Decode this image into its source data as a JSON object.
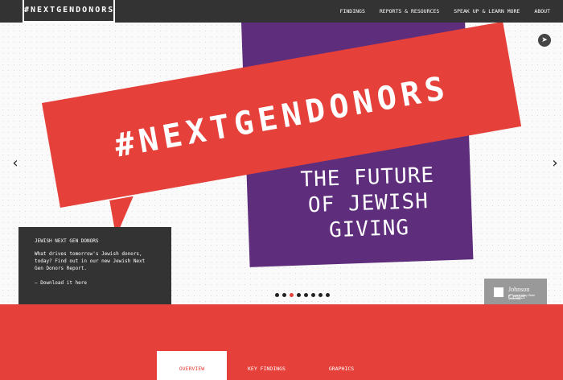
{
  "header": {
    "logo": "#NEXTGENDONORS",
    "nav": [
      "FINDINGS",
      "REPORTS & RESOURCES",
      "SPEAK UP & LEARN MORE",
      "ABOUT"
    ]
  },
  "hero": {
    "banner_text": "#NEXTGENDONORS",
    "subtitle_lines": [
      "THE FUTURE",
      "OF JEWISH",
      "GIVING"
    ],
    "prev_arrow": "‹",
    "next_arrow": "›",
    "info": {
      "title": "JEWISH NEXT GEN DONORS",
      "description": "What drives tomorrow's Jewish donors, today? Find out in our new Jewish Next Gen Donors Report.",
      "link": "— Download it here"
    },
    "slide_count": 8,
    "active_slide": 3,
    "partner": {
      "name": "Johnson Center",
      "sub": "at Grand Valley State University"
    }
  },
  "tabs": [
    {
      "label": "OVERVIEW",
      "active": true
    },
    {
      "label": "KEY FINDINGS",
      "active": false
    },
    {
      "label": "GRAPHICS",
      "active": false
    }
  ],
  "colors": {
    "red": "#e5403a",
    "purple": "#5e2d7c",
    "dark": "#333333"
  }
}
